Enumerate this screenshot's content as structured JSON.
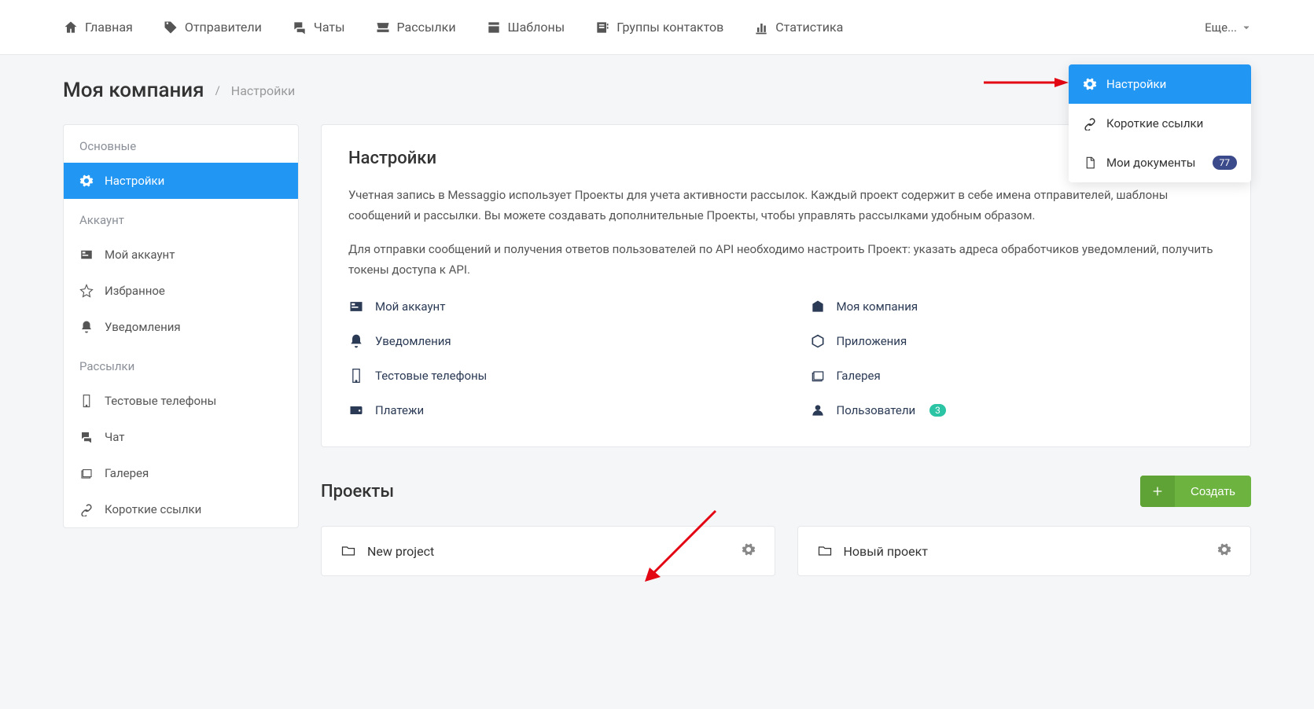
{
  "nav": {
    "items": [
      "Главная",
      "Отправители",
      "Чаты",
      "Рассылки",
      "Шаблоны",
      "Группы контактов",
      "Статистика"
    ],
    "more": "Еще..."
  },
  "breadcrumb": {
    "main": "Моя компания",
    "separator": "/",
    "sub": "Настройки"
  },
  "sidebar": {
    "sections": [
      {
        "title": "Основные",
        "items": [
          {
            "label": "Настройки",
            "active": true
          }
        ]
      },
      {
        "title": "Аккаунт",
        "items": [
          {
            "label": "Мой аккаунт"
          },
          {
            "label": "Избранное"
          },
          {
            "label": "Уведомления"
          }
        ]
      },
      {
        "title": "Рассылки",
        "items": [
          {
            "label": "Тестовые телефоны"
          },
          {
            "label": "Чат"
          },
          {
            "label": "Галерея"
          },
          {
            "label": "Короткие ссылки"
          }
        ]
      }
    ]
  },
  "settings_card": {
    "title": "Настройки",
    "p1": "Учетная запись в Messaggio использует Проекты для учета активности рассылок. Каждый проект содержит в себе имена отправителей, шаблоны сообщений и рассылки. Вы можете создавать дополнительные Проекты, чтобы управлять рассылками удобным образом.",
    "p2": "Для отправки сообщений и получения ответов пользователей по API необходимо настроить Проект: указать адреса обработчиков уведомлений, получить токены доступа к API.",
    "links_left": [
      "Мой аккаунт",
      "Уведомления",
      "Тестовые телефоны",
      "Платежи"
    ],
    "links_right": [
      "Моя компания",
      "Приложения",
      "Галерея",
      "Пользователи"
    ],
    "users_badge": "3"
  },
  "projects": {
    "title": "Проекты",
    "create": "Создать",
    "items": [
      "New project",
      "Новый проект"
    ]
  },
  "dropdown": {
    "items": [
      {
        "label": "Настройки",
        "active": true
      },
      {
        "label": "Короткие ссылки"
      },
      {
        "label": "Мои документы",
        "badge": "77"
      }
    ]
  }
}
